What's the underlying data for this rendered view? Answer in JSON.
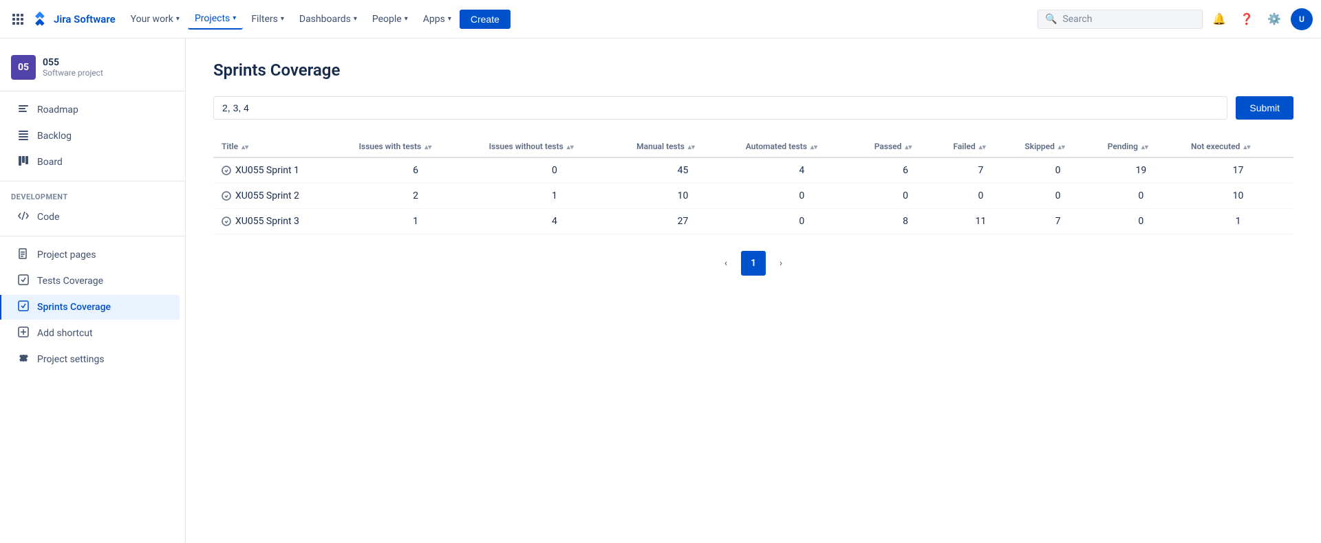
{
  "topnav": {
    "logo_text": "Jira Software",
    "nav_items": [
      {
        "id": "your-work",
        "label": "Your work",
        "chevron": true,
        "active": false
      },
      {
        "id": "projects",
        "label": "Projects",
        "chevron": true,
        "active": true
      },
      {
        "id": "filters",
        "label": "Filters",
        "chevron": true,
        "active": false
      },
      {
        "id": "dashboards",
        "label": "Dashboards",
        "chevron": true,
        "active": false
      },
      {
        "id": "people",
        "label": "People",
        "chevron": true,
        "active": false
      },
      {
        "id": "apps",
        "label": "Apps",
        "chevron": true,
        "active": false
      }
    ],
    "create_label": "Create",
    "search_placeholder": "Search",
    "avatar_initials": "U"
  },
  "sidebar": {
    "project_name": "055",
    "project_type": "Software project",
    "project_initials": "05",
    "nav_items": [
      {
        "id": "roadmap",
        "label": "Roadmap",
        "icon": "≡",
        "active": false
      },
      {
        "id": "backlog",
        "label": "Backlog",
        "icon": "☰",
        "active": false
      },
      {
        "id": "board",
        "label": "Board",
        "icon": "⊞",
        "active": false
      }
    ],
    "dev_section": "DEVELOPMENT",
    "dev_items": [
      {
        "id": "code",
        "label": "Code",
        "icon": "</>",
        "active": false
      }
    ],
    "bottom_items": [
      {
        "id": "project-pages",
        "label": "Project pages",
        "icon": "📄",
        "active": false
      },
      {
        "id": "tests-coverage",
        "label": "Tests Coverage",
        "icon": "T",
        "active": false
      },
      {
        "id": "sprints-coverage",
        "label": "Sprints Coverage",
        "icon": "T",
        "active": true
      },
      {
        "id": "add-shortcut",
        "label": "Add shortcut",
        "icon": "+",
        "active": false
      },
      {
        "id": "project-settings",
        "label": "Project settings",
        "icon": "⚙",
        "active": false
      }
    ]
  },
  "main": {
    "page_title": "Sprints Coverage",
    "filter_value": "2, 3, 4",
    "submit_label": "Submit",
    "table": {
      "columns": [
        {
          "id": "title",
          "label": "Title",
          "sortable": true
        },
        {
          "id": "issues_with_tests",
          "label": "Issues with tests",
          "sortable": true
        },
        {
          "id": "issues_without_tests",
          "label": "Issues without tests",
          "sortable": true
        },
        {
          "id": "manual_tests",
          "label": "Manual tests",
          "sortable": true
        },
        {
          "id": "automated_tests",
          "label": "Automated tests",
          "sortable": true
        },
        {
          "id": "passed",
          "label": "Passed",
          "sortable": true
        },
        {
          "id": "failed",
          "label": "Failed",
          "sortable": true
        },
        {
          "id": "skipped",
          "label": "Skipped",
          "sortable": true
        },
        {
          "id": "pending",
          "label": "Pending",
          "sortable": true
        },
        {
          "id": "not_executed",
          "label": "Not executed",
          "sortable": true
        }
      ],
      "rows": [
        {
          "title": "XU055 Sprint 1",
          "issues_with_tests": 6,
          "issues_without_tests": 0,
          "manual_tests": 45,
          "automated_tests": 4,
          "passed": 6,
          "failed": 7,
          "skipped": 0,
          "pending": 19,
          "not_executed": 17
        },
        {
          "title": "XU055 Sprint 2",
          "issues_with_tests": 2,
          "issues_without_tests": 1,
          "manual_tests": 10,
          "automated_tests": 0,
          "passed": 0,
          "failed": 0,
          "skipped": 0,
          "pending": 0,
          "not_executed": 10
        },
        {
          "title": "XU055 Sprint 3",
          "issues_with_tests": 1,
          "issues_without_tests": 4,
          "manual_tests": 27,
          "automated_tests": 0,
          "passed": 8,
          "failed": 11,
          "skipped": 7,
          "pending": 0,
          "not_executed": 1
        }
      ]
    },
    "pagination": {
      "prev_label": "‹",
      "next_label": "›",
      "current_page": 1,
      "pages": [
        1
      ]
    }
  }
}
